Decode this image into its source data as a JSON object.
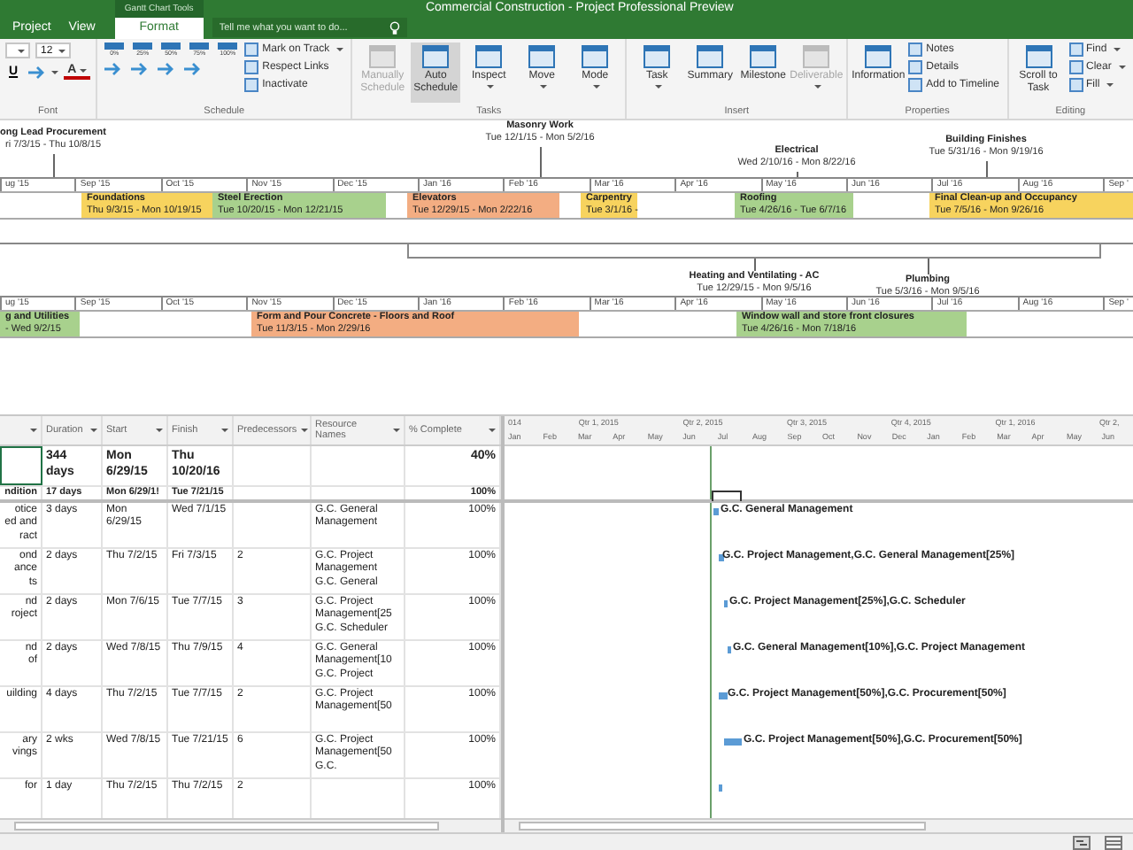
{
  "title_bar": {
    "title": "Commercial Construction - Project Professional Preview",
    "contextual_group": "Gantt Chart Tools"
  },
  "tabs": [
    {
      "label": "Project",
      "selected": false
    },
    {
      "label": "View",
      "selected": false
    },
    {
      "label": "Format",
      "selected": true
    }
  ],
  "tell_me": {
    "placeholder": "Tell me what you want to do..."
  },
  "ribbon": {
    "groups": [
      {
        "label": "Font",
        "items": [
          {
            "kind": "rows",
            "rows": [
              [
                {
                  "kind": "field"
                },
                {
                  "kind": "field",
                  "value": "12"
                }
              ],
              [
                {
                  "kind": "text_button",
                  "label": "U"
                },
                {
                  "kind": "icon_button",
                  "dropdown": true
                },
                {
                  "kind": "color_text",
                  "label": "A",
                  "dropdown": true
                }
              ]
            ]
          }
        ]
      },
      {
        "label": "Schedule",
        "items": [
          {
            "kind": "rows",
            "rows": [
              [
                {
                  "kind": "pct",
                  "label": "0%"
                },
                {
                  "kind": "pct",
                  "label": "25%"
                },
                {
                  "kind": "pct",
                  "label": "50%"
                },
                {
                  "kind": "pct",
                  "label": "75%"
                },
                {
                  "kind": "pct",
                  "label": "100%"
                }
              ],
              [
                {
                  "kind": "icon_button"
                },
                {
                  "kind": "icon_button"
                },
                {
                  "kind": "icon_button"
                },
                {
                  "kind": "icon_button"
                }
              ]
            ]
          },
          {
            "kind": "stack",
            "items": [
              {
                "label": "Mark on Track",
                "dropdown": true
              },
              {
                "label": "Respect Links",
                "dropdown": false
              },
              {
                "label": "Inactivate",
                "dropdown": false
              }
            ]
          }
        ]
      },
      {
        "label": "Tasks",
        "items": [
          {
            "kind": "large",
            "label": "Manually Schedule",
            "selected": false,
            "disabled": true,
            "dropdown": false
          },
          {
            "kind": "large",
            "label": "Auto Schedule",
            "selected": true,
            "disabled": false,
            "dropdown": false
          },
          {
            "kind": "large",
            "label": "Inspect",
            "selected": false,
            "disabled": false,
            "dropdown": true
          },
          {
            "kind": "large",
            "label": "Move",
            "selected": false,
            "disabled": false,
            "dropdown": true
          },
          {
            "kind": "large",
            "label": "Mode",
            "selected": false,
            "disabled": false,
            "dropdown": true
          }
        ]
      },
      {
        "label": "Insert",
        "items": [
          {
            "kind": "large",
            "label": "Task",
            "selected": false,
            "disabled": false,
            "dropdown": true
          },
          {
            "kind": "large",
            "label": "Summary",
            "selected": false,
            "disabled": false,
            "dropdown": false
          },
          {
            "kind": "large",
            "label": "Milestone",
            "selected": false,
            "disabled": false,
            "dropdown": false
          },
          {
            "kind": "large",
            "label": "Deliverable",
            "selected": false,
            "disabled": true,
            "dropdown": true
          }
        ]
      },
      {
        "label": "Properties",
        "items": [
          {
            "kind": "large",
            "label": "Information",
            "selected": false,
            "disabled": false,
            "dropdown": false
          },
          {
            "kind": "stack",
            "items": [
              {
                "label": "Notes",
                "dropdown": false
              },
              {
                "label": "Details",
                "dropdown": false
              },
              {
                "label": "Add to Timeline",
                "dropdown": false
              }
            ]
          }
        ]
      },
      {
        "label": "Editing",
        "items": [
          {
            "kind": "large",
            "label": "Scroll to Task",
            "selected": false,
            "disabled": false,
            "dropdown": false
          },
          {
            "kind": "stack",
            "items": [
              {
                "label": "Find",
                "dropdown": true
              },
              {
                "label": "Clear",
                "dropdown": true
              },
              {
                "label": "Fill",
                "dropdown": true
              }
            ]
          }
        ]
      }
    ]
  },
  "timeline": {
    "bands": [
      {
        "callouts": [
          {
            "name": "ong Lead Procurement",
            "dates": "ri 7/3/15 - Thu 10/8/15"
          },
          {
            "name": "Masonry Work",
            "dates": "Tue 12/1/15 - Mon 5/2/16"
          },
          {
            "name": "Electrical",
            "dates": "Wed 2/10/16 - Mon 8/22/16"
          },
          {
            "name": "Building Finishes",
            "dates": "Tue 5/31/16 - Mon 9/19/16"
          }
        ],
        "ticks": [
          "ug '15",
          "Sep '15",
          "Oct '15",
          "Nov '15",
          "Dec '15",
          "Jan '16",
          "Feb '16",
          "Mar '16",
          "Apr '16",
          "May '16",
          "Jun '16",
          "Jul '16",
          "Aug '16",
          "Sep '"
        ],
        "tasks": [
          {
            "name": "Foundations",
            "dates": "Thu 9/3/15 - Mon 10/19/15",
            "color": "#f7d35e"
          },
          {
            "name": "Steel Erection",
            "dates": "Tue 10/20/15 - Mon 12/21/15",
            "color": "#a8d18d"
          },
          {
            "name": "Elevators",
            "dates": "Tue 12/29/15 - Mon 2/22/16",
            "color": "#f3ad82"
          },
          {
            "name": "Carpentry",
            "dates": "Tue 3/1/16 -",
            "color": "#f7d35e"
          },
          {
            "name": "Roofing",
            "dates": "Tue 4/26/16 - Tue 6/7/16",
            "color": "#a8d18d"
          },
          {
            "name": "Final Clean-up and Occupancy",
            "dates": "Tue 7/5/16 - Mon 9/26/16",
            "color": "#f7d35e"
          }
        ]
      },
      {
        "callouts": [
          {
            "name": "Heating and Ventilating - AC",
            "dates": "Tue 12/29/15 - Mon 9/5/16"
          },
          {
            "name": "Plumbing",
            "dates": "Tue 5/3/16 - Mon 9/5/16"
          }
        ],
        "ticks": [
          "ug '15",
          "Sep '15",
          "Oct '15",
          "Nov '15",
          "Dec '15",
          "Jan '16",
          "Feb '16",
          "Mar '16",
          "Apr '16",
          "May '16",
          "Jun '16",
          "Jul '16",
          "Aug '16",
          "Sep '"
        ],
        "tasks": [
          {
            "name": "g and Utilities",
            "dates": "- Wed 9/2/15",
            "color": "#a8d18d"
          },
          {
            "name": "Form and Pour Concrete - Floors and Roof",
            "dates": "Tue 11/3/15 - Mon 2/29/16",
            "color": "#f3ad82"
          },
          {
            "name": "Window wall and store front closures",
            "dates": "Tue 4/26/16 - Mon 7/18/16",
            "color": "#a8d18d"
          }
        ]
      }
    ]
  },
  "table": {
    "columns": [
      "Duration",
      "Start",
      "Finish",
      "Predecessors",
      "Resource Names",
      "% Complete"
    ],
    "rows": [
      {
        "selected": true,
        "summary": true,
        "duration": "344 days",
        "start": "Mon 6/29/15",
        "finish": "Thu 10/20/16",
        "complete": "40%"
      },
      {
        "selected": false,
        "summary": true,
        "name_lines": [
          "ndition"
        ],
        "duration": "17 days",
        "start": "Mon 6/29/1!",
        "finish": "Tue 7/21/15",
        "complete": "100%"
      },
      {
        "selected": false,
        "summary": false,
        "name_lines": [
          "otice",
          "ed and",
          "ract"
        ],
        "duration": "3 days",
        "start": "Mon 6/29/15",
        "finish": "Wed 7/1/15",
        "resources": [
          "G.C. General",
          "Management"
        ],
        "complete": "100%",
        "gantt_label": "G.C. General Management"
      },
      {
        "selected": false,
        "summary": false,
        "name_lines": [
          "ond",
          "ance",
          "ts"
        ],
        "duration": "2 days",
        "start": "Thu 7/2/15",
        "finish": "Fri 7/3/15",
        "predecessors": "2",
        "resources": [
          "G.C. Project",
          "Management",
          "G.C. General"
        ],
        "complete": "100%",
        "gantt_label": "G.C. Project Management,G.C. General Management[25%]"
      },
      {
        "selected": false,
        "summary": false,
        "name_lines": [
          "nd",
          "roject"
        ],
        "duration": "2 days",
        "start": "Mon 7/6/15",
        "finish": "Tue 7/7/15",
        "predecessors": "3",
        "resources": [
          "G.C. Project",
          "Management[25",
          "G.C. Scheduler"
        ],
        "complete": "100%",
        "gantt_label": "G.C. Project Management[25%],G.C. Scheduler"
      },
      {
        "selected": false,
        "summary": false,
        "name_lines": [
          "nd",
          "of"
        ],
        "duration": "2 days",
        "start": "Wed 7/8/15",
        "finish": "Thu 7/9/15",
        "predecessors": "4",
        "resources": [
          "G.C. General",
          "Management[10",
          "G.C. Project"
        ],
        "complete": "100%",
        "gantt_label": "G.C. General Management[10%],G.C. Project Management"
      },
      {
        "selected": false,
        "summary": false,
        "name_lines": [
          "uilding"
        ],
        "duration": "4 days",
        "start": "Thu 7/2/15",
        "finish": "Tue 7/7/15",
        "predecessors": "2",
        "resources": [
          "G.C. Project",
          "Management[50"
        ],
        "complete": "100%",
        "gantt_label": "G.C. Project Management[50%],G.C. Procurement[50%]"
      },
      {
        "selected": false,
        "summary": false,
        "name_lines": [
          "ary",
          "vings"
        ],
        "duration": "2 wks",
        "start": "Wed 7/8/15",
        "finish": "Tue 7/21/15",
        "predecessors": "6",
        "resources": [
          "G.C. Project",
          "Management[50",
          "G.C."
        ],
        "complete": "100%",
        "gantt_label": "G.C. Project Management[50%],G.C. Procurement[50%]"
      },
      {
        "selected": false,
        "summary": false,
        "name_lines": [
          "for"
        ],
        "duration": "1 day",
        "start": "Thu 7/2/15",
        "finish": "Thu 7/2/15",
        "predecessors": "2",
        "complete": "100%"
      }
    ]
  },
  "gantt": {
    "quarters": [
      "014",
      "Qtr 1, 2015",
      "Qtr 2, 2015",
      "Qtr 3, 2015",
      "Qtr 4, 2015",
      "Qtr 1, 2016",
      "Qtr 2,"
    ],
    "months": [
      "Jan",
      "Feb",
      "Mar",
      "Apr",
      "May",
      "Jun",
      "Jul",
      "Aug",
      "Sep",
      "Oct",
      "Nov",
      "Dec",
      "Jan",
      "Feb",
      "Mar",
      "Apr",
      "May",
      "Jun"
    ]
  }
}
